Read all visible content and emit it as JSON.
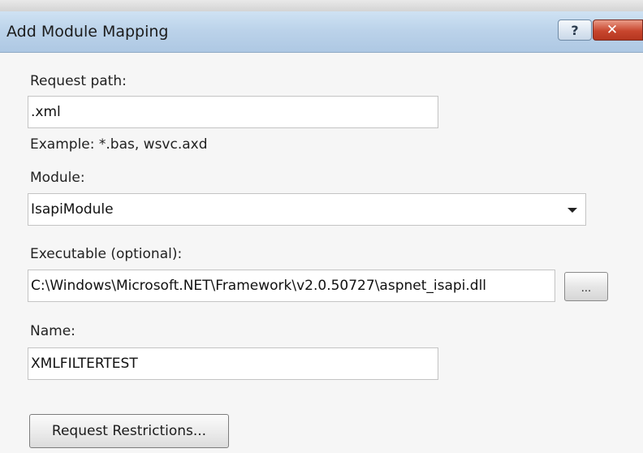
{
  "window": {
    "title": "Add Module Mapping",
    "help_label": "?",
    "close_label": "✕"
  },
  "request_path": {
    "label": "Request path:",
    "value": ".xml",
    "example": "Example: *.bas, wsvc.axd"
  },
  "module": {
    "label": "Module:",
    "selected": "IsapiModule"
  },
  "executable": {
    "label": "Executable (optional):",
    "value": "C:\\Windows\\Microsoft.NET\\Framework\\v2.0.50727\\aspnet_isapi.dll",
    "browse_label": "..."
  },
  "name": {
    "label": "Name:",
    "value": "XMLFILTERTEST"
  },
  "buttons": {
    "request_restrictions": "Request Restrictions..."
  }
}
